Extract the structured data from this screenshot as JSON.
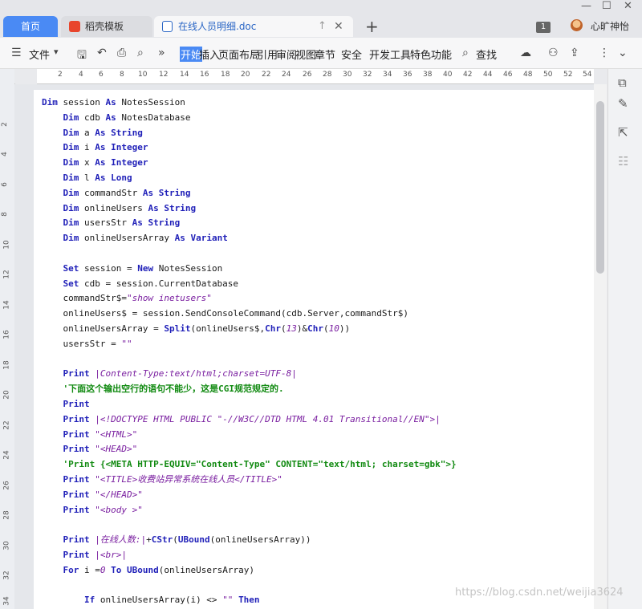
{
  "tabs": {
    "home": "首页",
    "docer": "稻壳模板",
    "document": "在线人员明细.doc"
  },
  "header": {
    "badge": "1",
    "username": "心旷神怡"
  },
  "toolbar": {
    "file": "文件",
    "menus": [
      "开始",
      "插入",
      "页面布局",
      "引用",
      "审阅",
      "视图",
      "章节",
      "安全",
      "开发工具",
      "特色功能"
    ],
    "search": "查找"
  },
  "ruler": {
    "h": [
      "2",
      "4",
      "6",
      "8",
      "10",
      "12",
      "14",
      "16",
      "18",
      "20",
      "22",
      "24",
      "26",
      "28",
      "30",
      "32",
      "34",
      "36",
      "38",
      "40",
      "42",
      "44",
      "46",
      "48",
      "50",
      "52",
      "54"
    ],
    "v": [
      "2",
      "4",
      "6",
      "8",
      "10",
      "12",
      "14",
      "16",
      "18",
      "20",
      "22",
      "24",
      "26",
      "28",
      "30",
      "32",
      "34"
    ]
  },
  "code": [
    [
      [
        "kw",
        "Dim"
      ],
      [
        "p",
        " session "
      ],
      [
        "kw",
        "As"
      ],
      [
        "p",
        " NotesSession"
      ]
    ],
    [
      [
        "p",
        "    "
      ],
      [
        "kw",
        "Dim"
      ],
      [
        "p",
        " cdb "
      ],
      [
        "kw",
        "As"
      ],
      [
        "p",
        " NotesDatabase"
      ]
    ],
    [
      [
        "p",
        "    "
      ],
      [
        "kw",
        "Dim"
      ],
      [
        "p",
        " a "
      ],
      [
        "kw",
        "As String"
      ]
    ],
    [
      [
        "p",
        "    "
      ],
      [
        "kw",
        "Dim"
      ],
      [
        "p",
        " i "
      ],
      [
        "kw",
        "As Integer"
      ]
    ],
    [
      [
        "p",
        "    "
      ],
      [
        "kw",
        "Dim"
      ],
      [
        "p",
        " x "
      ],
      [
        "kw",
        "As Integer"
      ]
    ],
    [
      [
        "p",
        "    "
      ],
      [
        "kw",
        "Dim"
      ],
      [
        "p",
        " l "
      ],
      [
        "kw",
        "As Long"
      ]
    ],
    [
      [
        "p",
        "    "
      ],
      [
        "kw",
        "Dim"
      ],
      [
        "p",
        " commandStr "
      ],
      [
        "kw",
        "As String"
      ]
    ],
    [
      [
        "p",
        "    "
      ],
      [
        "kw",
        "Dim"
      ],
      [
        "p",
        " onlineUsers "
      ],
      [
        "kw",
        "As String"
      ]
    ],
    [
      [
        "p",
        "    "
      ],
      [
        "kw",
        "Dim"
      ],
      [
        "p",
        " usersStr "
      ],
      [
        "kw",
        "As String"
      ]
    ],
    [
      [
        "p",
        "    "
      ],
      [
        "kw",
        "Dim"
      ],
      [
        "p",
        " onlineUsersArray "
      ],
      [
        "kw",
        "As Variant"
      ]
    ],
    [
      [
        "p",
        ""
      ]
    ],
    [
      [
        "p",
        "    "
      ],
      [
        "kw",
        "Set"
      ],
      [
        "p",
        " session = "
      ],
      [
        "kw",
        "New"
      ],
      [
        "p",
        " NotesSession"
      ]
    ],
    [
      [
        "p",
        "    "
      ],
      [
        "kw",
        "Set"
      ],
      [
        "p",
        " cdb = session.CurrentDatabase"
      ]
    ],
    [
      [
        "p",
        "    commandStr$="
      ],
      [
        "str",
        "\"show inetusers\""
      ]
    ],
    [
      [
        "p",
        "    onlineUsers$ = session.SendConsoleCommand(cdb.Server,commandStr$)"
      ]
    ],
    [
      [
        "p",
        "    onlineUsersArray = "
      ],
      [
        "kw",
        "Split"
      ],
      [
        "p",
        "(onlineUsers$,"
      ],
      [
        "kw",
        "Chr"
      ],
      [
        "p",
        "("
      ],
      [
        "num",
        "13"
      ],
      [
        "p",
        ")&"
      ],
      [
        "kw",
        "Chr"
      ],
      [
        "p",
        "("
      ],
      [
        "num",
        "10"
      ],
      [
        "p",
        "))"
      ]
    ],
    [
      [
        "p",
        "    usersStr = "
      ],
      [
        "str",
        "\"\""
      ]
    ],
    [
      [
        "p",
        ""
      ]
    ],
    [
      [
        "p",
        "    "
      ],
      [
        "kw",
        "Print"
      ],
      [
        "p",
        " "
      ],
      [
        "str",
        "|Content-Type:text/html;charset=UTF-8|"
      ]
    ],
    [
      [
        "p",
        "    "
      ],
      [
        "cm",
        "'下面这个输出空行的语句不能少，这是CGI规范规定的."
      ]
    ],
    [
      [
        "p",
        "    "
      ],
      [
        "kw",
        "Print"
      ]
    ],
    [
      [
        "p",
        "    "
      ],
      [
        "kw",
        "Print"
      ],
      [
        "p",
        " "
      ],
      [
        "str",
        "|<!DOCTYPE HTML PUBLIC \"-//W3C//DTD HTML 4.01 Transitional//EN\">|"
      ]
    ],
    [
      [
        "p",
        "    "
      ],
      [
        "kw",
        "Print"
      ],
      [
        "p",
        " "
      ],
      [
        "str",
        "\"<HTML>\""
      ]
    ],
    [
      [
        "p",
        "    "
      ],
      [
        "kw",
        "Print"
      ],
      [
        "p",
        " "
      ],
      [
        "str",
        "\"<HEAD>\""
      ]
    ],
    [
      [
        "p",
        "    "
      ],
      [
        "cm",
        "'Print {<META HTTP-EQUIV=\"Content-Type\" CONTENT=\"text/html; charset=gbk\">}"
      ]
    ],
    [
      [
        "p",
        "    "
      ],
      [
        "kw",
        "Print"
      ],
      [
        "p",
        " "
      ],
      [
        "str",
        "\"<TITLE>收费站异常系统在线人员</TITLE>\""
      ]
    ],
    [
      [
        "p",
        "    "
      ],
      [
        "kw",
        "Print"
      ],
      [
        "p",
        " "
      ],
      [
        "str",
        "\"</HEAD>\""
      ]
    ],
    [
      [
        "p",
        "    "
      ],
      [
        "kw",
        "Print"
      ],
      [
        "p",
        " "
      ],
      [
        "str",
        "\"<body >\""
      ]
    ],
    [
      [
        "p",
        ""
      ]
    ],
    [
      [
        "p",
        "    "
      ],
      [
        "kw",
        "Print"
      ],
      [
        "p",
        " "
      ],
      [
        "str",
        "|在线人数:|"
      ],
      [
        "p",
        "+"
      ],
      [
        "kw",
        "CStr"
      ],
      [
        "p",
        "("
      ],
      [
        "kw",
        "UBound"
      ],
      [
        "p",
        "(onlineUsersArray))"
      ]
    ],
    [
      [
        "p",
        "    "
      ],
      [
        "kw",
        "Print"
      ],
      [
        "p",
        " "
      ],
      [
        "str",
        "|<br>|"
      ]
    ],
    [
      [
        "p",
        "    "
      ],
      [
        "kw",
        "For"
      ],
      [
        "p",
        " i ="
      ],
      [
        "num",
        "0"
      ],
      [
        "p",
        " "
      ],
      [
        "kw",
        "To"
      ],
      [
        "p",
        " "
      ],
      [
        "kw",
        "UBound"
      ],
      [
        "p",
        "(onlineUsersArray)"
      ]
    ],
    [
      [
        "p",
        ""
      ]
    ],
    [
      [
        "p",
        "        "
      ],
      [
        "kw",
        "If"
      ],
      [
        "p",
        " onlineUsersArray(i) <> "
      ],
      [
        "str",
        "\"\""
      ],
      [
        "p",
        " "
      ],
      [
        "kw",
        "Then"
      ]
    ]
  ],
  "watermark": "https://blog.csdn.net/weijia3624"
}
